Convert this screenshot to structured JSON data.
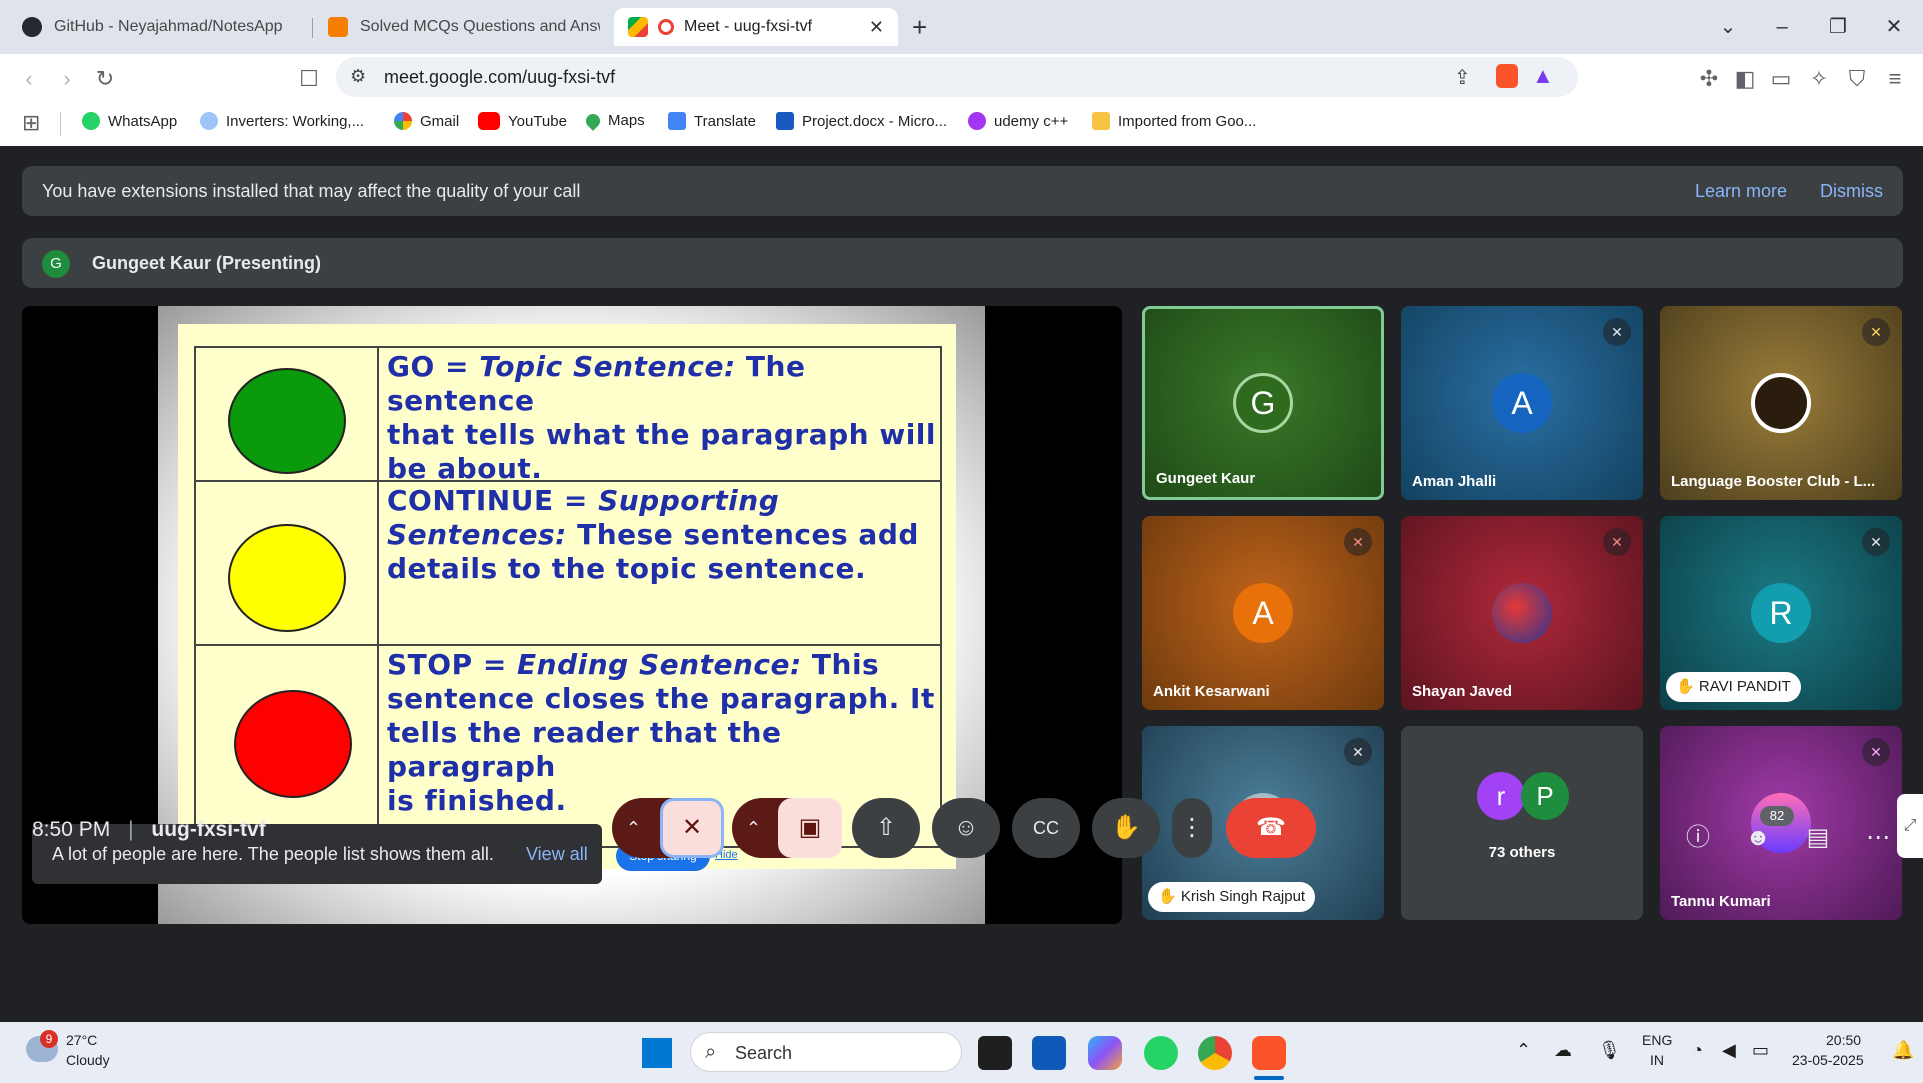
{
  "tabs": [
    {
      "title": "GitHub - Neyajahmad/NotesApp",
      "icon": "github-icon",
      "active": false
    },
    {
      "title": "Solved MCQs Questions and Answe",
      "icon": "blogger-icon",
      "active": false
    },
    {
      "title": "Meet - uug-fxsi-tvf",
      "icon": "meet-icon",
      "active": true
    }
  ],
  "address": {
    "url": "meet.google.com/uug-fxsi-tvf"
  },
  "bookmarks": [
    "WhatsApp",
    "Inverters: Working,...",
    "Gmail",
    "YouTube",
    "Maps",
    "Translate",
    "Project.docx - Micro...",
    "udemy c++",
    "Imported from Goo..."
  ],
  "banner": {
    "message": "You have extensions installed that may affect the quality of your call",
    "learn_more": "Learn more",
    "dismiss": "Dismiss"
  },
  "presenter": {
    "initial": "G",
    "label": "Gungeet Kaur (Presenting)"
  },
  "slide": {
    "go_line1": "GO = ",
    "go_em": "Topic Sentence:",
    "go_rest1": " The sentence",
    "go_line2": "that tells what the paragraph will",
    "go_line3": "be about.",
    "cont_line1": "CONTINUE = ",
    "cont_em1": "Supporting",
    "cont_em2": "Sentences:",
    "cont_rest2": " These sentences add",
    "cont_line3": "details to the topic sentence.",
    "stop_line1": "STOP = ",
    "stop_em": "Ending Sentence:",
    "stop_rest1": " This",
    "stop_line2": "sentence closes the paragraph.  It",
    "stop_line3": "tells the reader that the paragraph",
    "stop_line4": "is finished.",
    "colors": {
      "green": "#0b9a0b",
      "yellow": "#ffff00",
      "red": "#ff0000"
    }
  },
  "toast": {
    "message": "A lot of people are here. The people list shows them all.",
    "action": "View all"
  },
  "share": {
    "stop_sharing": "Stop sharing",
    "hide": "Hide"
  },
  "participants": [
    {
      "name": "Gungeet Kaur",
      "initial": "G"
    },
    {
      "name": "Aman Jhalli",
      "initial": "A"
    },
    {
      "name": "Language Booster Club - L...",
      "initial": ""
    },
    {
      "name": "Ankit Kesarwani",
      "initial": "A"
    },
    {
      "name": "Shayan Javed",
      "initial": ""
    },
    {
      "name": "RAVI PANDIT",
      "initial": "R"
    },
    {
      "name": "Krish Singh Rajput",
      "initial": ""
    },
    {
      "name": "73 others",
      "initial": "r",
      "initial2": "P"
    },
    {
      "name": "Tannu Kumari",
      "initial": ""
    }
  ],
  "meeting": {
    "time": "8:50 PM",
    "separator": "|",
    "code": "uug-fxsi-tvf",
    "people_count": "82"
  },
  "taskbar": {
    "weather_temp": "27°C",
    "weather_desc": "Cloudy",
    "weather_badge": "9",
    "search": "Search",
    "lang1": "ENG",
    "lang2": "IN",
    "clock_time": "20:50",
    "clock_date": "23-05-2025"
  }
}
